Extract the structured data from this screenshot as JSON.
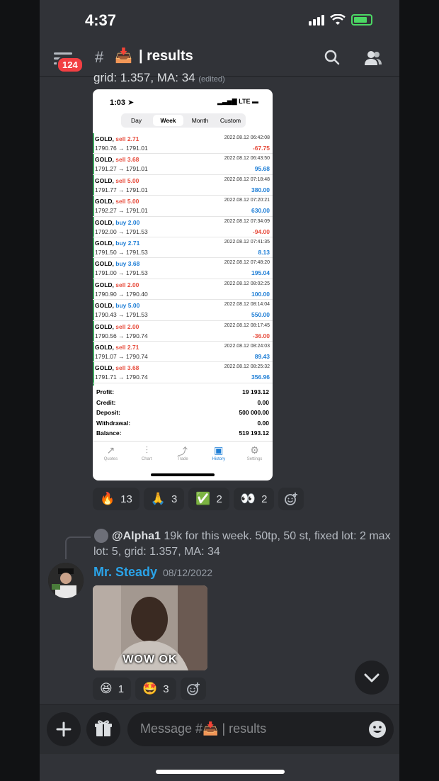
{
  "status": {
    "time": "4:37"
  },
  "header": {
    "badge": "124",
    "channel_emoji": "📥",
    "channel_name": "| results"
  },
  "partial_text": {
    "text": "grid: 1.357, MA: 34",
    "edited": "(edited)"
  },
  "screenshot": {
    "time": "1:03",
    "network": "LTE",
    "tabs": [
      "Day",
      "Week",
      "Month",
      "Custom"
    ],
    "active_tab": "Week",
    "trades": [
      {
        "sym": "GOLD,",
        "side": "sell",
        "lot": "2.71",
        "price": "1790.76 → 1791.01",
        "date": "2022.08.12 06:42:08",
        "profit": "-67.75"
      },
      {
        "sym": "GOLD,",
        "side": "sell",
        "lot": "3.68",
        "price": "1791.27 → 1791.01",
        "date": "2022.08.12 06:43:50",
        "profit": "95.68"
      },
      {
        "sym": "GOLD,",
        "side": "sell",
        "lot": "5.00",
        "price": "1791.77 → 1791.01",
        "date": "2022.08.12 07:18:48",
        "profit": "380.00"
      },
      {
        "sym": "GOLD,",
        "side": "sell",
        "lot": "5.00",
        "price": "1792.27 → 1791.01",
        "date": "2022.08.12 07:20:21",
        "profit": "630.00"
      },
      {
        "sym": "GOLD,",
        "side": "buy",
        "lot": "2.00",
        "price": "1792.00 → 1791.53",
        "date": "2022.08.12 07:34:09",
        "profit": "-94.00"
      },
      {
        "sym": "GOLD,",
        "side": "buy",
        "lot": "2.71",
        "price": "1791.50 → 1791.53",
        "date": "2022.08.12 07:41:35",
        "profit": "8.13"
      },
      {
        "sym": "GOLD,",
        "side": "buy",
        "lot": "3.68",
        "price": "1791.00 → 1791.53",
        "date": "2022.08.12 07:48:20",
        "profit": "195.04"
      },
      {
        "sym": "GOLD,",
        "side": "sell",
        "lot": "2.00",
        "price": "1790.90 → 1790.40",
        "date": "2022.08.12 08:02:25",
        "profit": "100.00"
      },
      {
        "sym": "GOLD,",
        "side": "buy",
        "lot": "5.00",
        "price": "1790.43 → 1791.53",
        "date": "2022.08.12 08:14:04",
        "profit": "550.00"
      },
      {
        "sym": "GOLD,",
        "side": "sell",
        "lot": "2.00",
        "price": "1790.56 → 1790.74",
        "date": "2022.08.12 08:17:45",
        "profit": "-36.00"
      },
      {
        "sym": "GOLD,",
        "side": "sell",
        "lot": "2.71",
        "price": "1791.07 → 1790.74",
        "date": "2022.08.12 08:24:03",
        "profit": "89.43"
      },
      {
        "sym": "GOLD,",
        "side": "sell",
        "lot": "3.68",
        "price": "1791.71 → 1790.74",
        "date": "2022.08.12 08:25:32",
        "profit": "356.96"
      }
    ],
    "summary": [
      {
        "label": "Profit:",
        "value": "19 193.12"
      },
      {
        "label": "Credit:",
        "value": "0.00"
      },
      {
        "label": "Deposit:",
        "value": "500 000.00"
      },
      {
        "label": "Withdrawal:",
        "value": "0.00"
      },
      {
        "label": "Balance:",
        "value": "519 193.12"
      }
    ],
    "bottom_tabs": [
      "Quotes",
      "Chart",
      "Trade",
      "History",
      "Settings"
    ],
    "active_bottom_tab": "History"
  },
  "reactions1": [
    {
      "emoji": "🔥",
      "count": "13"
    },
    {
      "emoji": "🙏",
      "count": "3"
    },
    {
      "emoji": "✅",
      "count": "2"
    },
    {
      "emoji": "👀",
      "count": "2"
    }
  ],
  "reply": {
    "user": "@Alpha1",
    "text": "19k for this week. 50tp, 50 st, fixed lot: 2 max lot: 5, grid: 1.357, MA: 34"
  },
  "message": {
    "username": "Mr. Steady",
    "date": "08/12/2022",
    "gif_caption": "WOW OK"
  },
  "reactions2": [
    {
      "emoji": "😆",
      "count": "1"
    },
    {
      "emoji": "🤩",
      "count": "3"
    }
  ],
  "composer": {
    "placeholder": "Message #📥 | results"
  }
}
